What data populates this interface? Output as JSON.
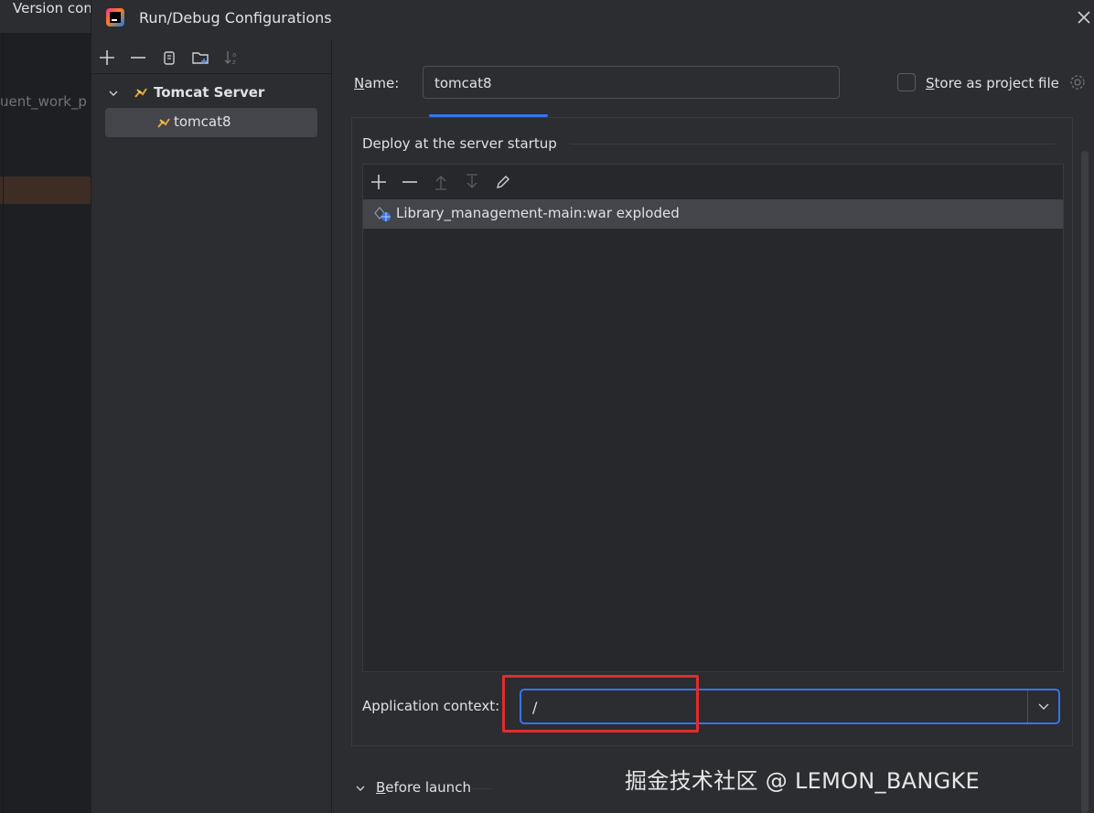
{
  "background": {
    "tab_label": "Version control",
    "ghost_text": "uent_work_p"
  },
  "dialog": {
    "title": "Run/Debug Configurations",
    "app_icon": "intellij-idea-icon",
    "close_icon": "close-icon"
  },
  "left_toolbar": {
    "icons": [
      "add-icon",
      "remove-icon",
      "copy-icon",
      "new-folder-icon",
      "sort-icon"
    ]
  },
  "tree": {
    "group_label": "Tomcat Server",
    "group_icon": "tomcat-icon",
    "item_label": "tomcat8",
    "item_icon": "tomcat-icon"
  },
  "form": {
    "name_label_key": "N",
    "name_label_rest": "ame:",
    "name_value": "tomcat8",
    "store_label_key": "S",
    "store_label_rest": "tore as project file",
    "store_checked": false
  },
  "deploy": {
    "title": "Deploy at the server startup",
    "toolbar_icons": [
      "add-icon",
      "remove-icon",
      "move-up-icon",
      "move-down-icon",
      "edit-icon"
    ],
    "artifacts": [
      {
        "label": "Library_management-main:war exploded",
        "icon": "web-artifact-icon"
      }
    ],
    "context_label": "Application context:",
    "context_value": "/"
  },
  "before_launch": {
    "label_key": "B",
    "label_rest": "efore launch"
  },
  "watermark": "掘金技术社区 @ LEMON_BANGKE",
  "colors": {
    "accent": "#3574f0",
    "highlight_box": "#e02d2d",
    "background": "#2b2d30"
  }
}
